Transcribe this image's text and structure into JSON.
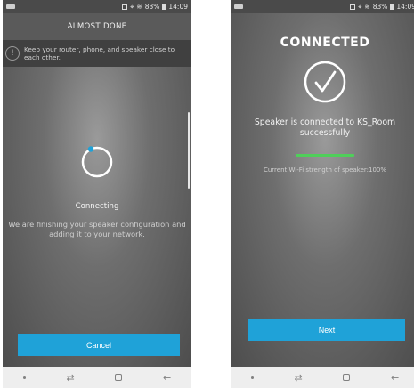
{
  "status_bar": {
    "battery": "83%",
    "time": "14:09"
  },
  "left_screen": {
    "title": "ALMOST DONE",
    "notice_text": "Keep your router, phone, and speaker close to each other.",
    "status_label": "Connecting",
    "description": "We are finishing your speaker configuration and adding it to your network.",
    "cancel_label": "Cancel"
  },
  "right_screen": {
    "title": "CONNECTED",
    "message": "Speaker is connected to KS_Room successfully",
    "wifi_strength_label": "Current Wi-Fi strength of speaker:100%",
    "wifi_strength_fraction": 1.0,
    "next_label": "Next"
  },
  "colors": {
    "accent": "#1fa2d8",
    "success_bar": "#4fcf5a"
  }
}
